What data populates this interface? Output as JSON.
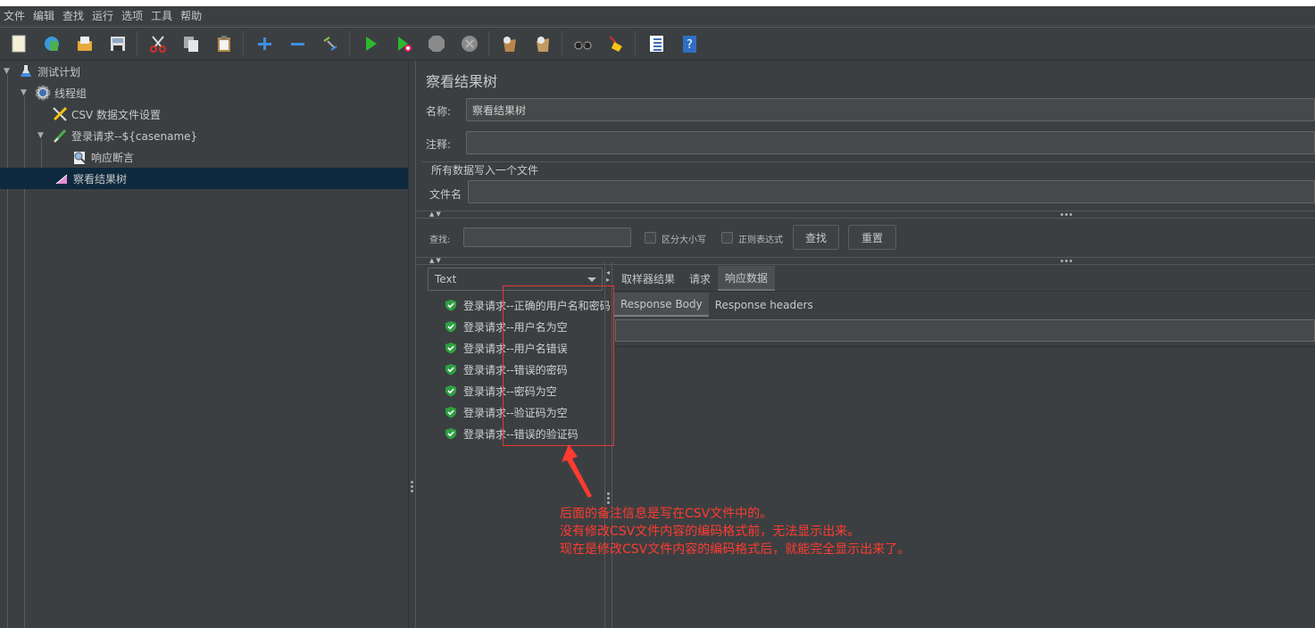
{
  "top_strip_text": "",
  "menu": [
    "文件",
    "编辑",
    "查找",
    "运行",
    "选项",
    "工具",
    "帮助"
  ],
  "toolbar": [
    {
      "icon": "new-icon",
      "group": 1
    },
    {
      "icon": "templates-icon",
      "group": 1
    },
    {
      "icon": "open-icon",
      "group": 1
    },
    {
      "icon": "save-icon",
      "group": 1
    },
    {
      "icon": "cut-icon",
      "group": 2
    },
    {
      "icon": "copy-icon",
      "group": 2
    },
    {
      "icon": "paste-icon",
      "group": 2
    },
    {
      "icon": "expand-icon",
      "group": 3
    },
    {
      "icon": "collapse-icon",
      "group": 3
    },
    {
      "icon": "toggle-icon",
      "group": 3
    },
    {
      "icon": "start-icon",
      "group": 4
    },
    {
      "icon": "start-no-pauses-icon",
      "group": 4
    },
    {
      "icon": "stop-icon",
      "group": 4
    },
    {
      "icon": "shutdown-icon",
      "group": 4
    },
    {
      "icon": "clear-icon",
      "group": 5
    },
    {
      "icon": "clear-all-icon",
      "group": 5
    },
    {
      "icon": "search-binoculars-icon",
      "group": 6
    },
    {
      "icon": "reset-broom-icon",
      "group": 6
    },
    {
      "icon": "function-helper-icon",
      "group": 7
    },
    {
      "icon": "help-icon",
      "group": 7
    }
  ],
  "tree": [
    {
      "label": "测试计划",
      "icon": "test-plan-icon",
      "level": 0,
      "expanded": true
    },
    {
      "label": "线程组",
      "icon": "thread-group-icon",
      "level": 1,
      "expanded": true
    },
    {
      "label": "CSV 数据文件设置",
      "icon": "csv-config-icon",
      "level": 2
    },
    {
      "label": "登录请求--${casename}",
      "icon": "sampler-icon",
      "level": 2,
      "expanded": true
    },
    {
      "label": "响应断言",
      "icon": "assertion-icon",
      "level": 3
    },
    {
      "label": "察看结果树",
      "icon": "listener-icon",
      "level": 2,
      "selected": true
    }
  ],
  "panel": {
    "title": "察看结果树",
    "name_label": "名称:",
    "name_value": "察看结果树",
    "comment_label": "注释:",
    "comment_value": "",
    "group_title": "所有数据写入一个文件",
    "filename_label": "文件名",
    "filename_value": "",
    "search_label": "查找:",
    "search_value": "",
    "case_sensitive_label": "区分大小写",
    "regex_label": "正则表达式",
    "find_button": "查找",
    "reset_button": "重置",
    "renderer": "Text",
    "results": [
      "登录请求--正确的用户名和密码",
      "登录请求--用户名为空",
      "登录请求--用户名错误",
      "登录请求--错误的密码",
      "登录请求--密码为空",
      "登录请求--验证码为空",
      "登录请求--错误的验证码"
    ],
    "tabs": [
      {
        "label": "取样器结果",
        "active": false
      },
      {
        "label": "请求",
        "active": false
      },
      {
        "label": "响应数据",
        "active": true
      }
    ],
    "subtabs": [
      {
        "label": "Response Body",
        "active": true
      },
      {
        "label": "Response headers",
        "active": false
      }
    ]
  },
  "annotation": {
    "color": "#ff3b30",
    "lines": [
      "后面的备注信息是写在CSV文件中的。",
      "没有修改CSV文件内容的编码格式前，无法显示出来。",
      "现在是修改CSV文件内容的编码格式后，就能完全显示出来了。"
    ]
  }
}
